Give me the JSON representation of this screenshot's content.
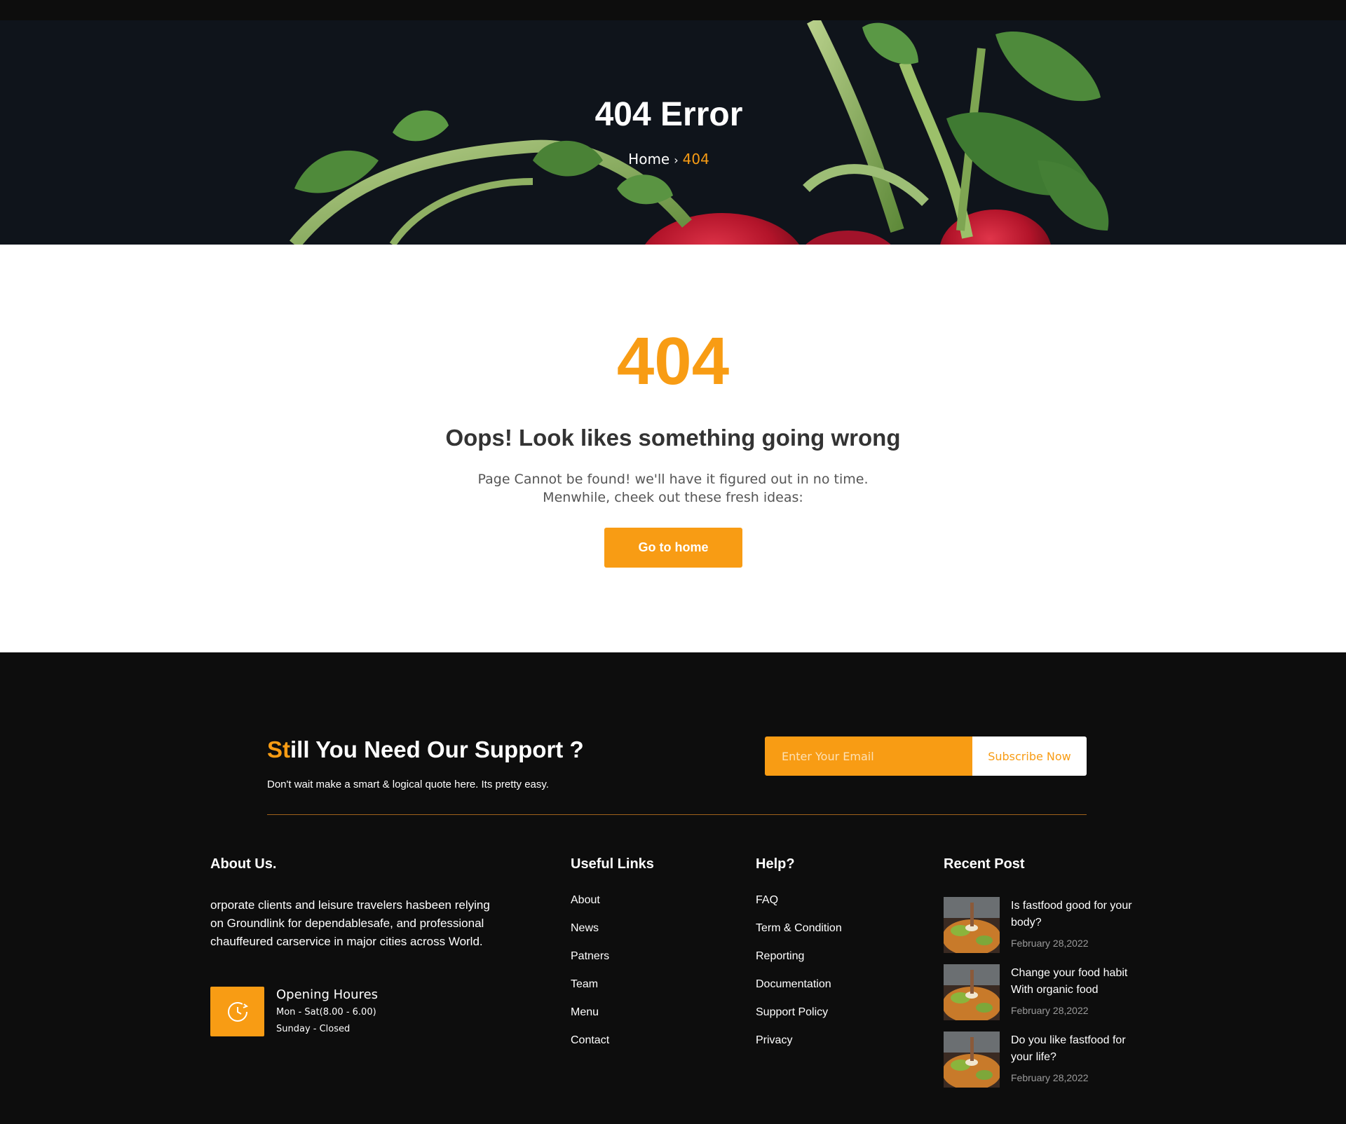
{
  "hero": {
    "title": "404 Error",
    "breadcrumb": {
      "home": "Home",
      "separator": "›",
      "current": "404"
    }
  },
  "main": {
    "code": "404",
    "headline": "Oops! Look likes something going wrong",
    "message_line1": "Page Cannot be found! we'll have it figured out in no time.",
    "message_line2": "Menwhile, cheek out these fresh ideas:",
    "button": "Go to home"
  },
  "support": {
    "title_accent": "St",
    "title_rest": "ill You Need Our Support ?",
    "subtitle": "Don't wait make a smart & logical quote here. Its pretty easy.",
    "email_placeholder": "Enter Your Email",
    "subscribe_button": "Subscribe Now"
  },
  "about": {
    "heading": "About Us.",
    "text": "orporate clients and leisure travelers hasbeen relying on Groundlink for dependablesafe, and professional chauffeured carservice in major cities across World.",
    "hours_title": "Opening Houres",
    "hours_weekdays": "Mon - Sat(8.00 - 6.00)",
    "hours_sunday": "Sunday - Closed"
  },
  "useful_links": {
    "heading": "Useful Links",
    "items": [
      "About",
      "News",
      "Patners",
      "Team",
      "Menu",
      "Contact"
    ]
  },
  "help": {
    "heading": "Help?",
    "items": [
      "FAQ",
      "Term & Condition",
      "Reporting",
      "Documentation",
      "Support Policy",
      "Privacy"
    ]
  },
  "recent": {
    "heading": "Recent Post",
    "posts": [
      {
        "title": "Is fastfood good for your body?",
        "date": "February 28,2022"
      },
      {
        "title": "Change your food habit With organic food",
        "date": "February 28,2022"
      },
      {
        "title": "Do you like fastfood for your life?",
        "date": "February 28,2022"
      }
    ]
  },
  "colors": {
    "accent": "#f89c14",
    "dark": "#0d0d0d",
    "hero_bg": "#0f141b"
  },
  "icons": {
    "hours": "clock-icon",
    "breadcrumb_separator": "chevron-right-icon"
  }
}
